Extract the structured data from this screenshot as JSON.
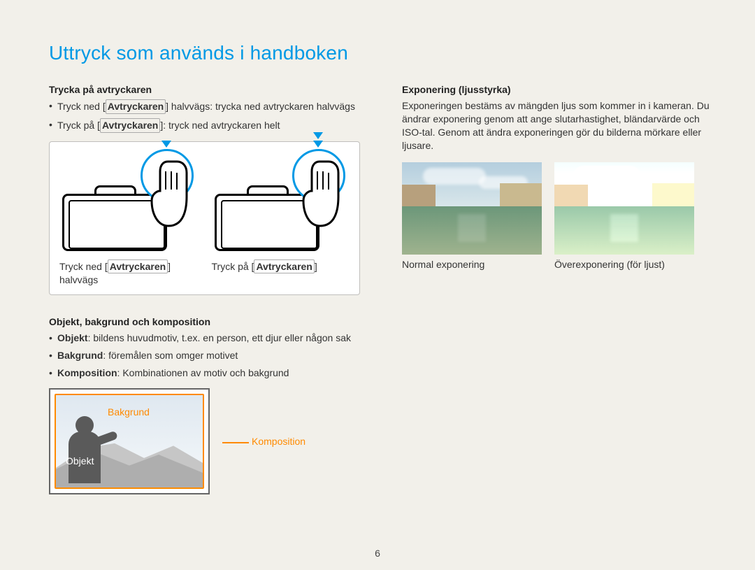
{
  "title": "Uttryck som används i handboken",
  "left": {
    "section1": {
      "heading": "Trycka på avtryckaren",
      "bullets": [
        {
          "pre": "Tryck ned [",
          "key": "Avtryckaren",
          "post1": "] halvvägs: trycka ned avtryckaren halvvägs"
        },
        {
          "pre": "Tryck på [",
          "key": "Avtryckaren",
          "post1": "]: tryck ned avtryckaren helt"
        }
      ],
      "captions": [
        {
          "pre": "Tryck ned [",
          "key": "Avtryckaren",
          "post": "] halvvägs"
        },
        {
          "pre": "Tryck på [",
          "key": "Avtryckaren",
          "post": "]"
        }
      ]
    },
    "section2": {
      "heading": "Objekt, bakgrund och komposition",
      "bullets": [
        {
          "bold": "Objekt",
          "rest": ": bildens huvudmotiv, t.ex. en person, ett djur eller någon sak"
        },
        {
          "bold": "Bakgrund",
          "rest": ": föremålen som omger motivet"
        },
        {
          "bold": "Komposition",
          "rest": ": Kombinationen av motiv och bakgrund"
        }
      ],
      "labels": {
        "bakgrund": "Bakgrund",
        "objekt": "Objekt",
        "komposition": "Komposition"
      }
    }
  },
  "right": {
    "heading": "Exponering (ljusstyrka)",
    "body": "Exponeringen bestäms av mängden ljus som kommer in i kameran. Du ändrar exponering genom att ange slutarhastighet, bländarvärde och ISO-tal. Genom att ändra exponeringen gör du bilderna mörkare eller ljusare.",
    "captions": {
      "normal": "Normal exponering",
      "over": "Överexponering (för ljust)"
    }
  },
  "page_number": "6"
}
